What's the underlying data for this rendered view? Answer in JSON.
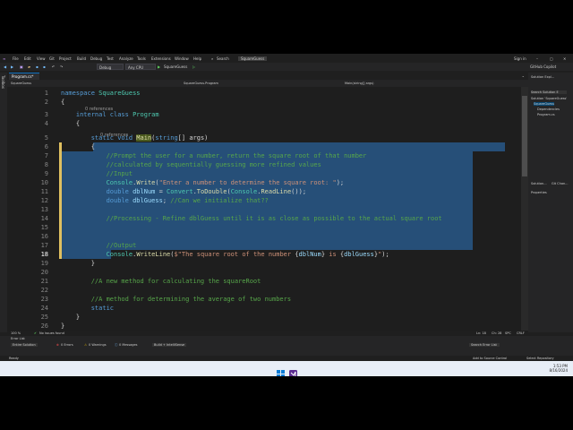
{
  "menu": {
    "items": [
      "File",
      "Edit",
      "View",
      "Git",
      "Project",
      "Build",
      "Debug",
      "Test",
      "Analyze",
      "Tools",
      "Extensions",
      "Window",
      "Help"
    ],
    "search": "Search",
    "solution_name": "SquareGuess",
    "sign_in": "Sign in"
  },
  "toolbar": {
    "config": "Debug",
    "platform": "Any CPU",
    "start_project": "SquareGuess",
    "copilot": "GitHub Copilot"
  },
  "tab": {
    "label": "Program.cs*"
  },
  "nav": {
    "project": "SquareGuess",
    "class": "SquareGuess.Program",
    "member": "Main(string[] args)"
  },
  "code": {
    "references_class": "0 references",
    "references_main": "0 references",
    "lines": [
      {
        "n": "1",
        "parts": [
          [
            "kw",
            "namespace "
          ],
          [
            "ty",
            "SquareGuess"
          ]
        ]
      },
      {
        "n": "2",
        "parts": [
          [
            "pl",
            "{"
          ]
        ]
      },
      {
        "n": "3",
        "parts": [
          [
            "pl",
            "    "
          ],
          [
            "kw",
            "internal class "
          ],
          [
            "ty",
            "Program"
          ]
        ]
      },
      {
        "n": "4",
        "parts": [
          [
            "pl",
            "    {"
          ]
        ]
      },
      {
        "n": "5",
        "parts": [
          [
            "pl",
            "        "
          ],
          [
            "kw",
            "static void "
          ],
          [
            "fnhl",
            "Main"
          ],
          [
            "pl",
            "("
          ],
          [
            "kw",
            "string"
          ],
          [
            "pl",
            "[] args)"
          ]
        ]
      },
      {
        "n": "6",
        "parts": [
          [
            "pl",
            "        {"
          ]
        ]
      },
      {
        "n": "7",
        "parts": [
          [
            "cm",
            "            //Prompt the user for a number, return the square root of that number"
          ]
        ]
      },
      {
        "n": "8",
        "parts": [
          [
            "cm",
            "            //calculated by sequentially guessing more refined values"
          ]
        ]
      },
      {
        "n": "9",
        "parts": [
          [
            "cm",
            "            //Input"
          ]
        ]
      },
      {
        "n": "10",
        "parts": [
          [
            "pl",
            "            "
          ],
          [
            "ty",
            "Console"
          ],
          [
            "pl",
            "."
          ],
          [
            "fn",
            "Write"
          ],
          [
            "pl",
            "("
          ],
          [
            "st",
            "\"Enter a number to determine the square root: \""
          ],
          [
            "pl",
            ");"
          ]
        ]
      },
      {
        "n": "11",
        "parts": [
          [
            "pl",
            "            "
          ],
          [
            "kw",
            "double "
          ],
          [
            "va",
            "dblNum"
          ],
          [
            "pl",
            " = "
          ],
          [
            "ty",
            "Convert"
          ],
          [
            "pl",
            "."
          ],
          [
            "fn",
            "ToDouble"
          ],
          [
            "pl",
            "("
          ],
          [
            "ty",
            "Console"
          ],
          [
            "pl",
            "."
          ],
          [
            "fn",
            "ReadLine"
          ],
          [
            "pl",
            "());"
          ]
        ]
      },
      {
        "n": "12",
        "parts": [
          [
            "pl",
            "            "
          ],
          [
            "kw",
            "double "
          ],
          [
            "va",
            "dblGuess"
          ],
          [
            "pl",
            "; "
          ],
          [
            "cm",
            "//Can we initialize that??"
          ]
        ]
      },
      {
        "n": "13",
        "parts": [
          [
            "pl",
            ""
          ]
        ]
      },
      {
        "n": "14",
        "parts": [
          [
            "cm",
            "            //Processing - Refine dblGuess until it is as close as possible to the actual square root"
          ]
        ]
      },
      {
        "n": "15",
        "parts": [
          [
            "pl",
            ""
          ]
        ]
      },
      {
        "n": "16",
        "parts": [
          [
            "pl",
            ""
          ]
        ]
      },
      {
        "n": "17",
        "parts": [
          [
            "cm",
            "            //Output"
          ]
        ]
      },
      {
        "n": "18",
        "parts": [
          [
            "pl",
            "            "
          ],
          [
            "ty",
            "Console"
          ],
          [
            "pl",
            "."
          ],
          [
            "fn",
            "WriteLine"
          ],
          [
            "pl",
            "("
          ],
          [
            "st",
            "$\"The square root of the number "
          ],
          [
            "pl",
            "{"
          ],
          [
            "va",
            "dblNum"
          ],
          [
            "pl",
            "}"
          ],
          [
            "st",
            " is "
          ],
          [
            "pl",
            "{"
          ],
          [
            "va",
            "dblGuess"
          ],
          [
            "pl",
            "}"
          ],
          [
            "st",
            "\""
          ],
          [
            "pl",
            ");"
          ]
        ]
      },
      {
        "n": "19",
        "parts": [
          [
            "pl",
            "        }"
          ]
        ]
      },
      {
        "n": "20",
        "parts": [
          [
            "pl",
            ""
          ]
        ]
      },
      {
        "n": "21",
        "parts": [
          [
            "cm",
            "        //A new method for calculating the squareRoot"
          ]
        ]
      },
      {
        "n": "22",
        "parts": [
          [
            "pl",
            ""
          ]
        ]
      },
      {
        "n": "23",
        "parts": [
          [
            "cm",
            "        //A method for determining the average of two numbers"
          ]
        ]
      },
      {
        "n": "24",
        "parts": [
          [
            "pl",
            "        "
          ],
          [
            "kw",
            "static"
          ]
        ]
      },
      {
        "n": "25",
        "parts": [
          [
            "pl",
            "    }"
          ]
        ]
      },
      {
        "n": "26",
        "parts": [
          [
            "pl",
            "}"
          ]
        ]
      }
    ]
  },
  "editor_status": {
    "zoom": "100 %",
    "issues": "No issues found",
    "position": "Ln: 18",
    "column": "Ch: 28",
    "spc": "SPC",
    "crlf": "CRLF"
  },
  "solution_explorer": {
    "title": "Solution Expl...",
    "search": "Search Solution E",
    "items": [
      "Solution 'SquareGuess'",
      "SquareGuess",
      "Dependencies",
      "Program.cs"
    ],
    "tabs": [
      "Solution...",
      "Git Chan..."
    ],
    "properties": "Properties"
  },
  "error_list": {
    "title": "Error List",
    "scope": "Entire Solution",
    "errors": "0 Errors",
    "warnings": "0 Warnings",
    "messages": "0 Messages",
    "build": "Build + IntelliSense",
    "search": "Search Error List"
  },
  "vs_status": {
    "ready": "Ready",
    "source_control": "Add to Source Control",
    "repository": "Select Repository"
  },
  "taskbar": {
    "time": "1:53 PM",
    "date": "8/16/2024"
  },
  "colors": {
    "accent": "#0e70c0",
    "selection": "#264f78",
    "background": "#1e1e1e"
  }
}
